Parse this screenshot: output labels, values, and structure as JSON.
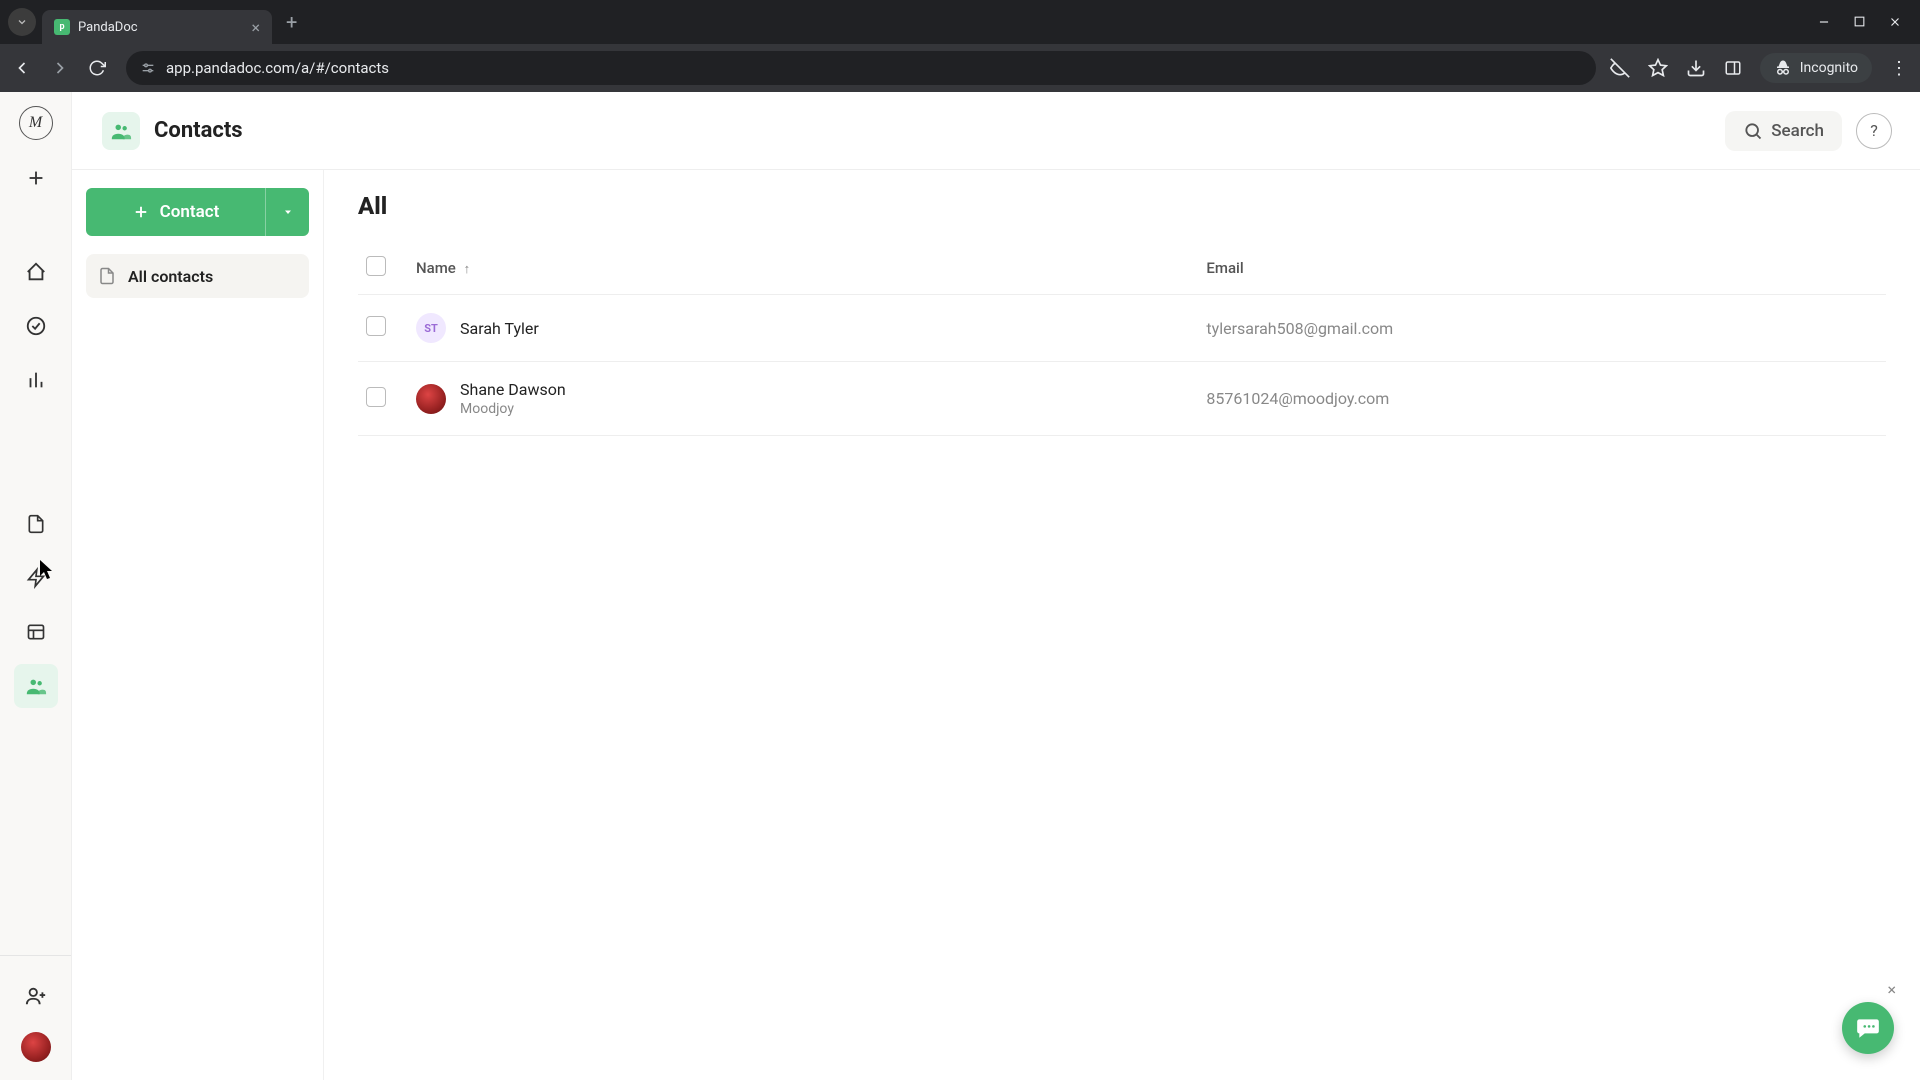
{
  "browser": {
    "tab_title": "PandaDoc",
    "url": "app.pandadoc.com/a/#/contacts",
    "incognito_label": "Incognito"
  },
  "header": {
    "title": "Contacts",
    "search_label": "Search"
  },
  "sidebar": {
    "primary_button_label": "Contact",
    "items": [
      {
        "label": "All contacts"
      }
    ]
  },
  "list": {
    "title": "All",
    "columns": {
      "name": "Name",
      "email": "Email"
    },
    "rows": [
      {
        "initials": "ST",
        "name": "Sarah Tyler",
        "company": "",
        "email": "tylersarah508@gmail.com",
        "avatar": "initials"
      },
      {
        "initials": "",
        "name": "Shane Dawson",
        "company": "Moodjoy",
        "email": "85761024@moodjoy.com",
        "avatar": "image"
      }
    ]
  }
}
